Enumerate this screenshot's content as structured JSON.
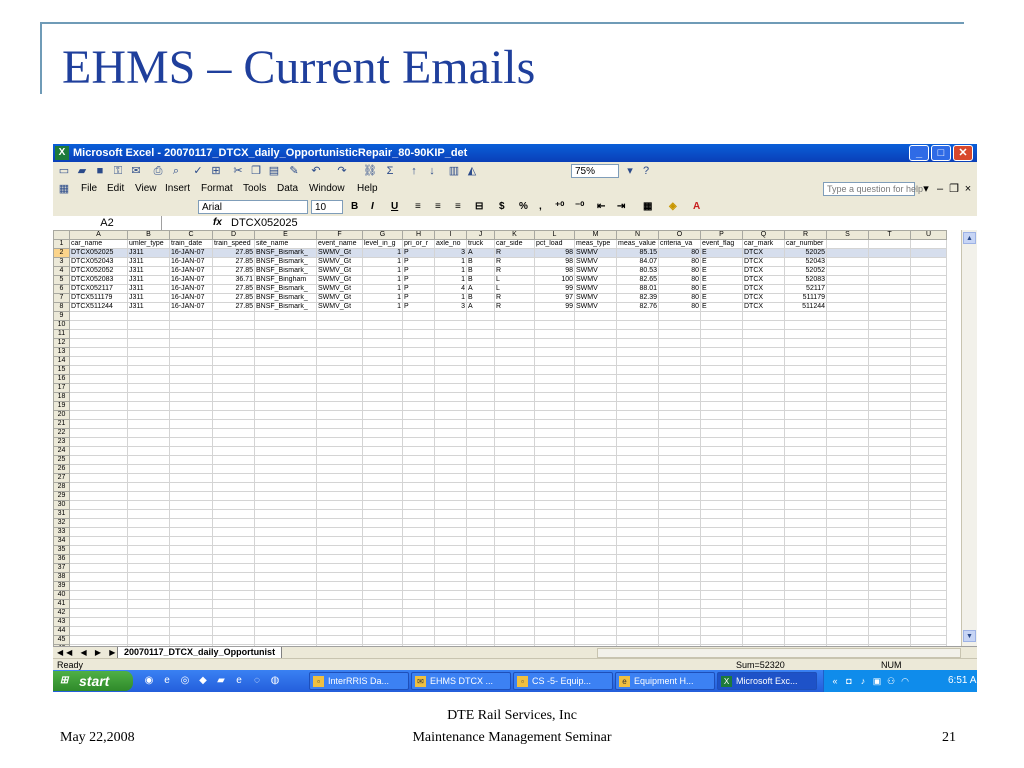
{
  "slide": {
    "title": "EHMS – Current Emails",
    "footer_date": "May 22,2008",
    "footer_line1": "DTE Rail Services, Inc",
    "footer_line2": "Maintenance Management Seminar",
    "page_number": "21"
  },
  "colors": {
    "title": "#1f3f9c",
    "rule": "#6f9bb7",
    "xp_blue": "#245edb",
    "excel_green": "#1d7a3a"
  },
  "window": {
    "title": "Microsoft Excel - 20070117_DTCX_daily_OpportunisticRepair_80-90KIP_det",
    "app_icon": "excel-icon"
  },
  "toolbar": {
    "zoom": "75%"
  },
  "menu": {
    "items": [
      "File",
      "Edit",
      "View",
      "Insert",
      "Format",
      "Tools",
      "Data",
      "Window",
      "Help"
    ],
    "ask_placeholder": "Type a question for help"
  },
  "format": {
    "font": "Arial",
    "size": "10"
  },
  "formula": {
    "cell": "A2",
    "fx": "fx",
    "value": "DTCX052025"
  },
  "sheet": {
    "columns": [
      "A",
      "B",
      "C",
      "D",
      "E",
      "F",
      "G",
      "H",
      "I",
      "J",
      "K",
      "L",
      "M",
      "N",
      "O",
      "P",
      "Q",
      "R",
      "S",
      "T",
      "U"
    ],
    "rows": [
      [
        "car_name",
        "umler_type",
        "train_date",
        "train_speed",
        "site_name",
        "event_name",
        "level_in_g",
        "pri_or_r",
        "axle_no",
        "truck",
        "car_side",
        "pct_load",
        "meas_type",
        "meas_value",
        "criteria_va",
        "event_flag",
        "car_mark",
        "car_number",
        "",
        "",
        ""
      ],
      [
        "DTCX052025",
        "J311",
        "16-JAN-07",
        "27.85",
        "BNSF_Bismark_",
        "SWMV_Gt",
        "1",
        "P",
        "3",
        "A",
        "R",
        "98",
        "SWMV",
        "85.15",
        "80",
        "E",
        "DTCX",
        "52025",
        "",
        "",
        ""
      ],
      [
        "DTCX052043",
        "J311",
        "16-JAN-07",
        "27.85",
        "BNSF_Bismark_",
        "SWMV_Gt",
        "1",
        "P",
        "1",
        "B",
        "R",
        "98",
        "SWMV",
        "84.07",
        "80",
        "E",
        "DTCX",
        "52043",
        "",
        "",
        ""
      ],
      [
        "DTCX052052",
        "J311",
        "16-JAN-07",
        "27.85",
        "BNSF_Bismark_",
        "SWMV_Gt",
        "1",
        "P",
        "1",
        "B",
        "R",
        "98",
        "SWMV",
        "80.53",
        "80",
        "E",
        "DTCX",
        "52052",
        "",
        "",
        ""
      ],
      [
        "DTCX052083",
        "J311",
        "16-JAN-07",
        "36.71",
        "BNSF_Bingham",
        "SWMV_Gt",
        "1",
        "P",
        "1",
        "B",
        "L",
        "100",
        "SWMV",
        "82.65",
        "80",
        "E",
        "DTCX",
        "52083",
        "",
        "",
        ""
      ],
      [
        "DTCX052117",
        "J311",
        "16-JAN-07",
        "27.85",
        "BNSF_Bismark_",
        "SWMV_Gt",
        "1",
        "P",
        "4",
        "A",
        "L",
        "99",
        "SWMV",
        "88.01",
        "80",
        "E",
        "DTCX",
        "52117",
        "",
        "",
        ""
      ],
      [
        "DTCX511179",
        "J311",
        "16-JAN-07",
        "27.85",
        "BNSF_Bismark_",
        "SWMV_Gt",
        "1",
        "P",
        "1",
        "B",
        "R",
        "97",
        "SWMV",
        "82.39",
        "80",
        "E",
        "DTCX",
        "511179",
        "",
        "",
        ""
      ],
      [
        "DTCX511244",
        "J311",
        "16-JAN-07",
        "27.85",
        "BNSF_Bismark_",
        "SWMV_Gt",
        "1",
        "P",
        "3",
        "A",
        "R",
        "99",
        "SWMV",
        "82.76",
        "80",
        "E",
        "DTCX",
        "511244",
        "",
        "",
        ""
      ]
    ],
    "total_rows": 46,
    "selected_row": 2,
    "tab_name": "20070117_DTCX_daily_Opportunist"
  },
  "status": {
    "ready": "Ready",
    "sum": "Sum=52320",
    "num": "NUM"
  },
  "taskbar": {
    "start": "start",
    "tasks": [
      {
        "label": "InterRRIS Da...",
        "active": false
      },
      {
        "label": "EHMS DTCX ...",
        "active": false
      },
      {
        "label": "CS -5- Equip...",
        "active": false
      },
      {
        "label": "Equipment H...",
        "active": false
      },
      {
        "label": "Microsoft Exc...",
        "active": true
      }
    ],
    "clock": "6:51 AM"
  }
}
